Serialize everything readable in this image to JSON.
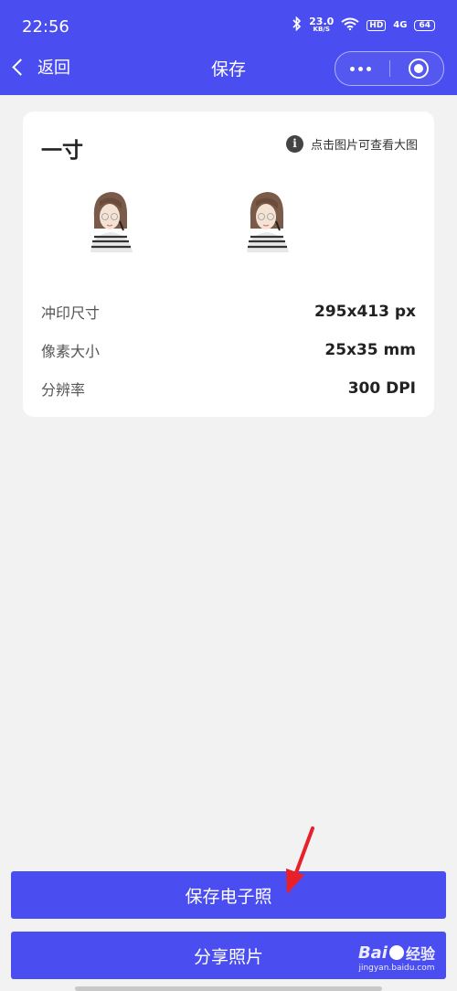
{
  "status": {
    "time": "22:56",
    "net_speed": "23.0",
    "net_unit": "KB/S",
    "hd": "HD",
    "signal": "4G",
    "battery": "64"
  },
  "nav": {
    "back_label": "返回",
    "title": "保存"
  },
  "card": {
    "title": "一寸",
    "hint": "点击图片可查看大图",
    "specs": [
      {
        "label": "冲印尺寸",
        "value": "295x413 px"
      },
      {
        "label": "像素大小",
        "value": "25x35 mm"
      },
      {
        "label": "分辨率",
        "value": "300 DPI"
      }
    ]
  },
  "buttons": {
    "save": "保存电子照",
    "share": "分享照片"
  },
  "watermark": {
    "brand": "Bai",
    "brand_suffix": "经验",
    "url": "jingyan.baidu.com"
  },
  "colors": {
    "accent": "#4a4ef0",
    "arrow": "#e8202a"
  }
}
